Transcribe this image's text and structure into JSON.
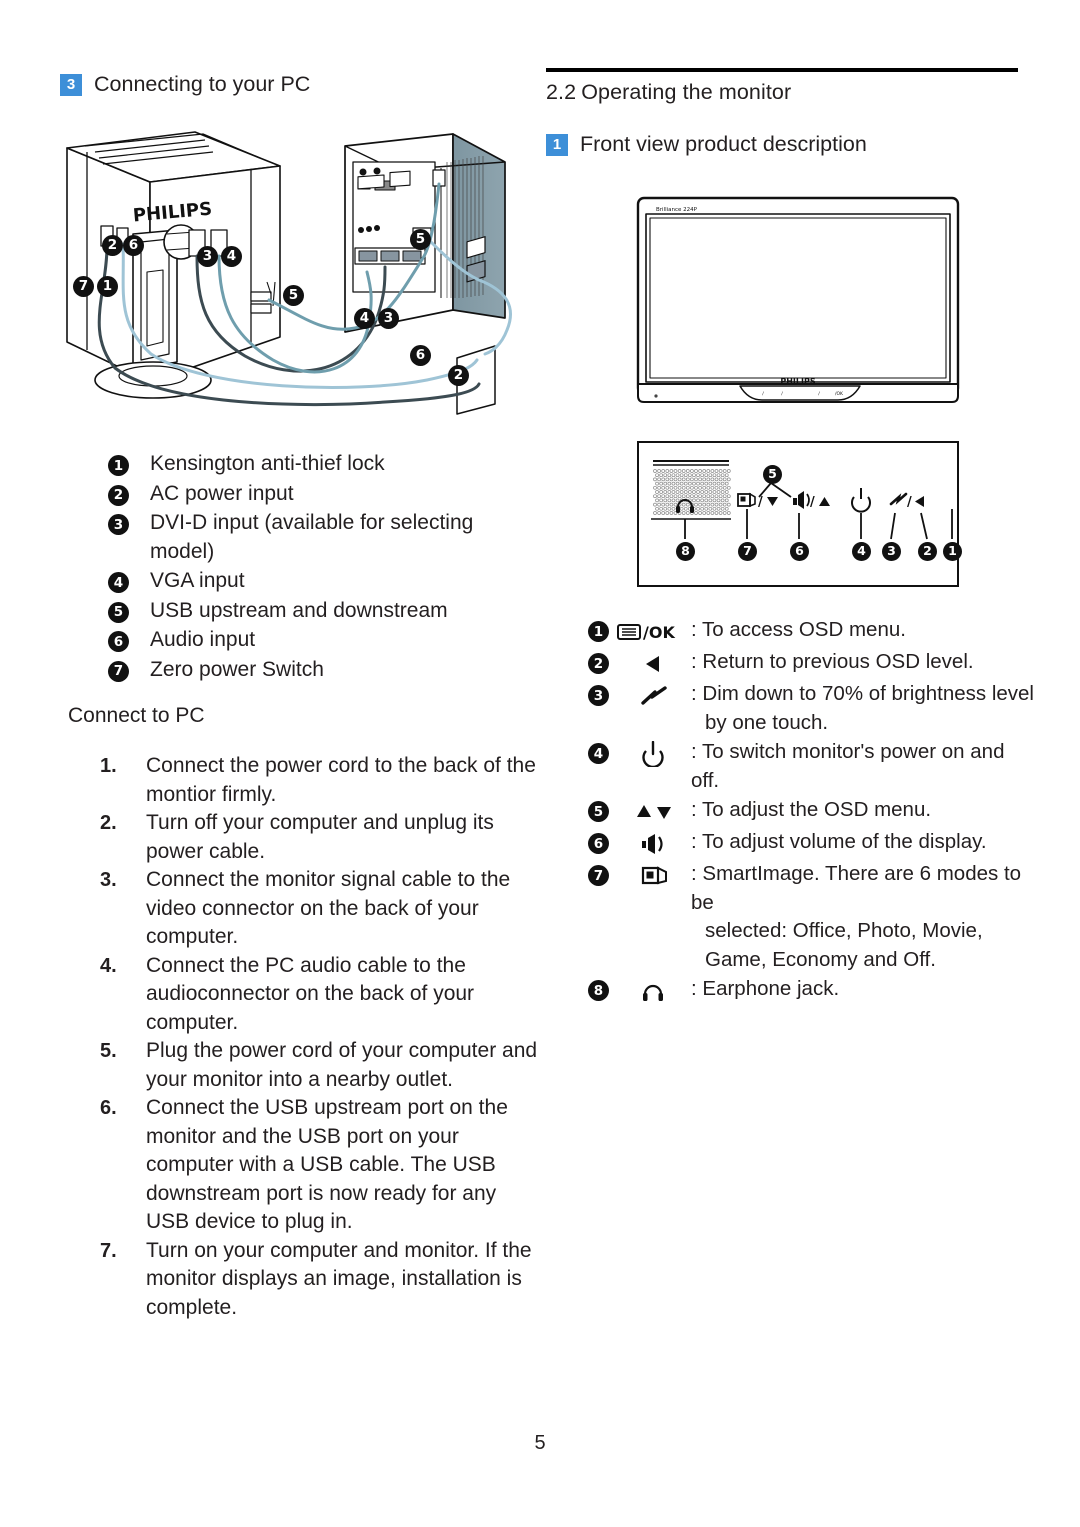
{
  "page": {
    "number": "5"
  },
  "left_column": {
    "heading": {
      "badge": "3",
      "title": "Connecting to your PC"
    },
    "figure": {
      "brand": "PHILIPS",
      "callouts": [
        "1",
        "2",
        "3",
        "4",
        "5",
        "6",
        "7"
      ]
    },
    "ports": [
      {
        "num": "1",
        "label": "Kensington anti-thief lock"
      },
      {
        "num": "2",
        "label": "AC power input"
      },
      {
        "num": "3",
        "label": "DVI-D input (available for selecting model)"
      },
      {
        "num": "4",
        "label": "VGA input"
      },
      {
        "num": "5",
        "label": "USB upstream and downstream"
      },
      {
        "num": "6",
        "label": "Audio input"
      },
      {
        "num": "7",
        "label": "Zero power Switch"
      }
    ],
    "connect_title": "Connect to PC",
    "steps": [
      {
        "num": "1.",
        "text": "Connect the power cord to the back of the montior firmly."
      },
      {
        "num": "2.",
        "text": "Turn off your computer and unplug its power cable."
      },
      {
        "num": "3.",
        "text": "Connect the monitor signal cable to the video connector on the back of your computer."
      },
      {
        "num": "4.",
        "text": "Connect the PC audio cable to the audioconnector on the back of your computer."
      },
      {
        "num": "5.",
        "text": "Plug the power cord of your computer and your monitor into a nearby outlet."
      },
      {
        "num": "6.",
        "text": "Connect the USB upstream port on the monitor and the USB port on your computer with a USB cable. The USB downstream port is now ready for any USB device to plug in."
      },
      {
        "num": "7.",
        "text": "Turn on your computer and monitor. If the monitor displays an image, installation is complete."
      }
    ]
  },
  "right_column": {
    "section": {
      "number": "2.2",
      "title": "Operating the monitor"
    },
    "heading": {
      "badge": "1",
      "title": "Front view product description"
    },
    "monitor_figure": {
      "screen_label": "Brilliance 224P",
      "brand": "PHILIPS"
    },
    "panel_figure": {
      "callouts": [
        "1",
        "2",
        "3",
        "4",
        "5",
        "6",
        "7",
        "8"
      ],
      "button_labels": {
        "menu_ok": "/OK",
        "smartimage_down": "/",
        "volume_up": "/"
      }
    },
    "osd_legend": [
      {
        "num": "1",
        "icon": "menu-ok-icon",
        "icon_text": "/OK",
        "desc": ": To access OSD menu.",
        "desc_cont": ""
      },
      {
        "num": "2",
        "icon": "left-arrow-icon",
        "icon_text": "",
        "desc": ": Return to previous OSD level.",
        "desc_cont": ""
      },
      {
        "num": "3",
        "icon": "smartcontrast-icon",
        "icon_text": "",
        "desc": ": Dim down to 70% of brightness level",
        "desc_cont": "by one touch."
      },
      {
        "num": "4",
        "icon": "power-icon",
        "icon_text": "",
        "desc": ": To switch monitor's power on and off.",
        "desc_cont": ""
      },
      {
        "num": "5",
        "icon": "up-down-arrow-icon",
        "icon_text": "",
        "desc": ": To adjust the OSD menu.",
        "desc_cont": ""
      },
      {
        "num": "6",
        "icon": "volume-icon",
        "icon_text": "",
        "desc": ": To adjust volume of the display.",
        "desc_cont": ""
      },
      {
        "num": "7",
        "icon": "smartimage-icon",
        "icon_text": "",
        "desc": ": SmartImage. There are 6 modes to be",
        "desc_cont": "selected: Office, Photo, Movie, Game, Economy and Off."
      },
      {
        "num": "8",
        "icon": "earphone-icon",
        "icon_text": "",
        "desc": ": Earphone jack.",
        "desc_cont": ""
      }
    ]
  },
  "colors": {
    "badge_blue": "#3d8fd8",
    "text": "#231f20",
    "rule": "#000000",
    "case_gray": "#7e96a1",
    "cable_blue": "#9fc4d6"
  }
}
